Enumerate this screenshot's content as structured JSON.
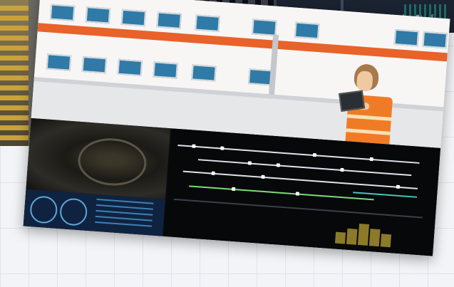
{
  "image": {
    "kind": "collage",
    "elements": [
      "escalator-photo-thumbnail",
      "dashboard-strip-thumbnail",
      "tilted-main-card"
    ]
  },
  "dashboard_strip": {
    "icons": [
      "play-icon",
      "signal-icon",
      "rotate-icon",
      "pencil-icon",
      "grid-icon",
      "edit-icon"
    ],
    "label_a": "≤",
    "label_b": "⟂",
    "label_c": "⟳"
  },
  "main_card": {
    "top_illustration": "train-and-worker",
    "bottom_panels": [
      "tunnel-camera-view",
      "cab-instrument-panel",
      "track-schematic"
    ]
  },
  "colors": {
    "accent_orange": "#e8622a",
    "vest_orange": "#f07b27",
    "window_blue": "#2f7aa6",
    "schematic_green": "#7ddc78",
    "schematic_cyan": "#46c8c0"
  }
}
